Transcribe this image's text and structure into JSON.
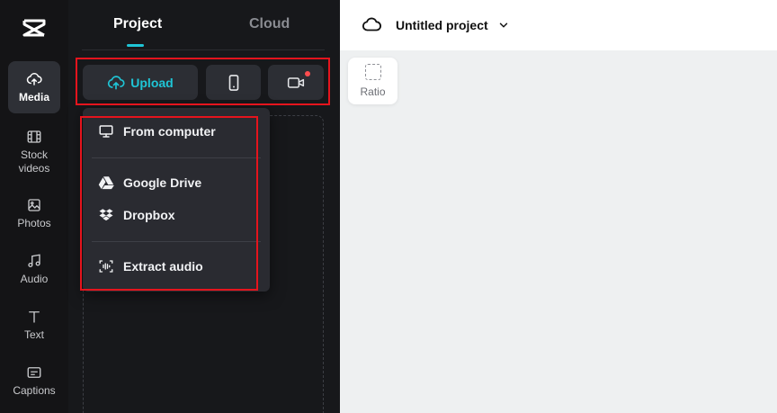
{
  "rail": {
    "items": [
      {
        "label": "Media",
        "active": true
      },
      {
        "label": "Stock videos"
      },
      {
        "label": "Photos"
      },
      {
        "label": "Audio"
      },
      {
        "label": "Text"
      },
      {
        "label": "Captions"
      }
    ]
  },
  "panel": {
    "tabs": [
      {
        "label": "Project",
        "active": true
      },
      {
        "label": "Cloud"
      }
    ],
    "upload_label": "Upload"
  },
  "menu": {
    "items": [
      {
        "label": "From computer",
        "icon": "monitor-icon"
      },
      {
        "label": "Google Drive",
        "icon": "google-drive-icon"
      },
      {
        "label": "Dropbox",
        "icon": "dropbox-icon"
      },
      {
        "label": "Extract audio",
        "icon": "extract-audio-icon"
      }
    ]
  },
  "header": {
    "project_title": "Untitled project"
  },
  "canvas": {
    "ratio_label": "Ratio"
  },
  "colors": {
    "accent": "#1fc5d6",
    "highlight": "#e5141d",
    "record_dot": "#ff4d4f"
  }
}
